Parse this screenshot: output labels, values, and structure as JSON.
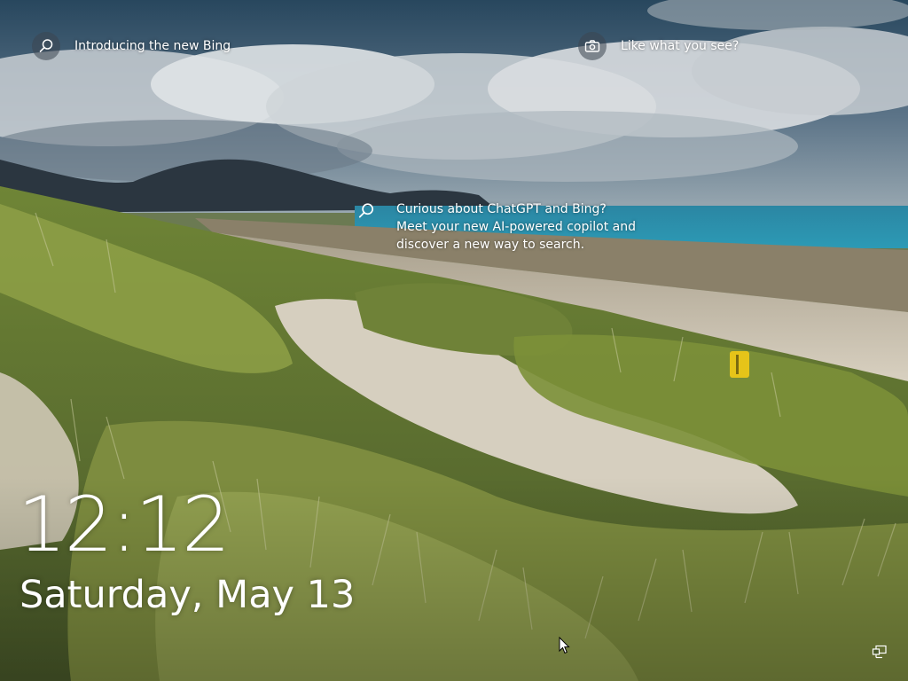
{
  "spotlight": {
    "bing_hotspot": {
      "text": "Introducing the new Bing",
      "icon": "search-icon"
    },
    "like_hotspot": {
      "text": "Like what you see?",
      "icon": "camera-icon"
    },
    "chat_hotspot": {
      "text": "Curious about ChatGPT and Bing? Meet your new AI-powered copilot and discover a new way to search.",
      "icon": "search-icon"
    }
  },
  "clock": {
    "time": "12:12",
    "date": "Saturday, May 13"
  },
  "status": {
    "network_icon": "network-icon"
  },
  "colors": {
    "sky_top": "#2e4a60",
    "sea": "#2f8faa",
    "sand": "#d9d2c3",
    "grass": "#7a8f3c",
    "text": "#ffffff"
  }
}
